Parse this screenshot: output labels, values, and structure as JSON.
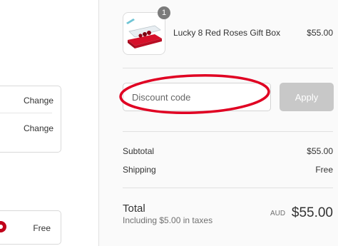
{
  "contact": {
    "change_label_1": "Change",
    "change_label_2": "Change"
  },
  "shipping_method": {
    "price": "Free"
  },
  "order": {
    "item_count": "1",
    "product_name": "Lucky 8 Red Roses Gift Box",
    "product_price": "$55.00"
  },
  "discount": {
    "placeholder": "Discount code",
    "apply_label": "Apply"
  },
  "summary": {
    "subtotal_label": "Subtotal",
    "subtotal_value": "$55.00",
    "shipping_label": "Shipping",
    "shipping_value": "Free",
    "total_label": "Total",
    "tax_note": "Including $5.00 in taxes",
    "currency": "AUD",
    "total_value": "$55.00"
  },
  "colors": {
    "accent": "#c0001a",
    "annotation_red": "#e00022",
    "apply_disabled": "#c8c8c8"
  }
}
